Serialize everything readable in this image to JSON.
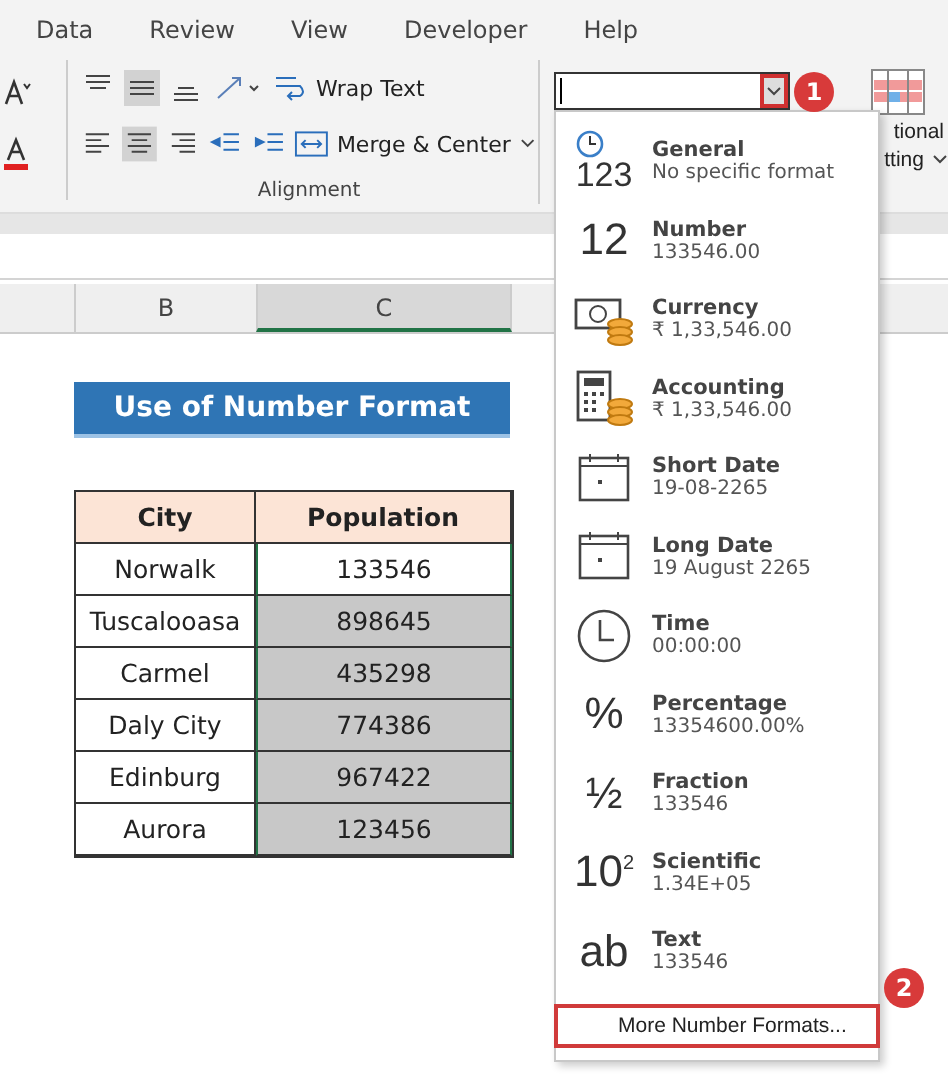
{
  "ribbon": {
    "tabs": [
      {
        "label": "Data",
        "selected": false
      },
      {
        "label": "Review",
        "selected": false
      },
      {
        "label": "View",
        "selected": false
      },
      {
        "label": "Developer",
        "selected": false
      },
      {
        "label": "Help",
        "selected": false
      }
    ],
    "alignment": {
      "wrap_text": "Wrap Text",
      "merge_center": "Merge & Center",
      "group_label": "Alignment"
    },
    "conditional_formatting": {
      "line_1": "tional",
      "line_2": "tting"
    }
  },
  "columns": [
    {
      "label": "B",
      "selected": false
    },
    {
      "label": "C",
      "selected": true
    }
  ],
  "sheet": {
    "title": "Use of Number Format",
    "headers": [
      "City",
      "Population"
    ],
    "rows": [
      {
        "city": "Norwalk",
        "population": "133546",
        "selected": false
      },
      {
        "city": "Tuscalooasa",
        "population": "898645",
        "selected": true
      },
      {
        "city": "Carmel",
        "population": "435298",
        "selected": true
      },
      {
        "city": "Daly City",
        "population": "774386",
        "selected": true
      },
      {
        "city": "Edinburg",
        "population": "967422",
        "selected": true
      },
      {
        "city": "Aurora",
        "population": "123456",
        "selected": true
      }
    ]
  },
  "format_dropdown": {
    "badge": "1",
    "items": [
      {
        "kind": "general",
        "glyph": "123",
        "name": "General",
        "example": "No specific format"
      },
      {
        "kind": "glyph",
        "glyph": "12",
        "name": "Number",
        "example": "133546.00"
      },
      {
        "kind": "currency",
        "name": "Currency",
        "example": "₹ 1,33,546.00"
      },
      {
        "kind": "accounting",
        "name": "Accounting",
        "example": "₹ 1,33,546.00"
      },
      {
        "kind": "calendar",
        "name": "Short Date",
        "example": "19-08-2265"
      },
      {
        "kind": "calendar",
        "name": "Long Date",
        "example": "19 August 2265"
      },
      {
        "kind": "clock",
        "name": "Time",
        "example": "00:00:00"
      },
      {
        "kind": "glyph",
        "glyph": "%",
        "name": "Percentage",
        "example": "13354600.00%"
      },
      {
        "kind": "glyph",
        "glyph": "½",
        "name": "Fraction",
        "example": "133546"
      },
      {
        "kind": "scientific",
        "glyph": "10",
        "sup": "2",
        "name": "Scientific",
        "example": "1.34E+05"
      },
      {
        "kind": "glyph",
        "glyph": "ab",
        "name": "Text",
        "example": "133546"
      }
    ],
    "more": "More Number Formats...",
    "more_badge": "2"
  }
}
